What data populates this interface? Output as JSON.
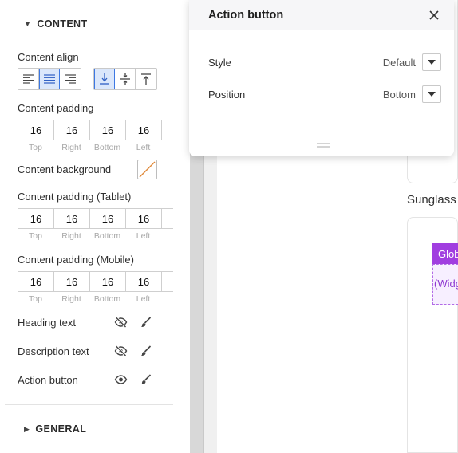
{
  "sidebar": {
    "content_section": "CONTENT",
    "content_align_label": "Content align",
    "content_padding_label": "Content padding",
    "content_padding": [
      {
        "value": "16",
        "caption": "Top"
      },
      {
        "value": "16",
        "caption": "Right"
      },
      {
        "value": "16",
        "caption": "Bottom"
      },
      {
        "value": "16",
        "caption": "Left"
      }
    ],
    "content_background_label": "Content background",
    "content_padding_tablet_label": "Content padding (Tablet)",
    "content_padding_tablet": [
      {
        "value": "16",
        "caption": "Top"
      },
      {
        "value": "16",
        "caption": "Right"
      },
      {
        "value": "16",
        "caption": "Bottom"
      },
      {
        "value": "16",
        "caption": "Left"
      }
    ],
    "content_padding_mobile_label": "Content padding (Mobile)",
    "content_padding_mobile": [
      {
        "value": "16",
        "caption": "Top"
      },
      {
        "value": "16",
        "caption": "Right"
      },
      {
        "value": "16",
        "caption": "Bottom"
      },
      {
        "value": "16",
        "caption": "Left"
      }
    ],
    "heading_text_label": "Heading text",
    "description_text_label": "Description text",
    "action_button_label": "Action button",
    "general_section": "GENERAL"
  },
  "popover": {
    "title": "Action button",
    "style_label": "Style",
    "style_value": "Default",
    "position_label": "Position",
    "position_value": "Bottom"
  },
  "canvas": {
    "heading_fragment": "Sunglass",
    "tag_fragment": "Glob",
    "widget_fragment": "(Widg"
  },
  "colors": {
    "accent_blue": "#3d78e3",
    "active_bg": "#dbe7fb",
    "purple": "#a13ee0"
  }
}
